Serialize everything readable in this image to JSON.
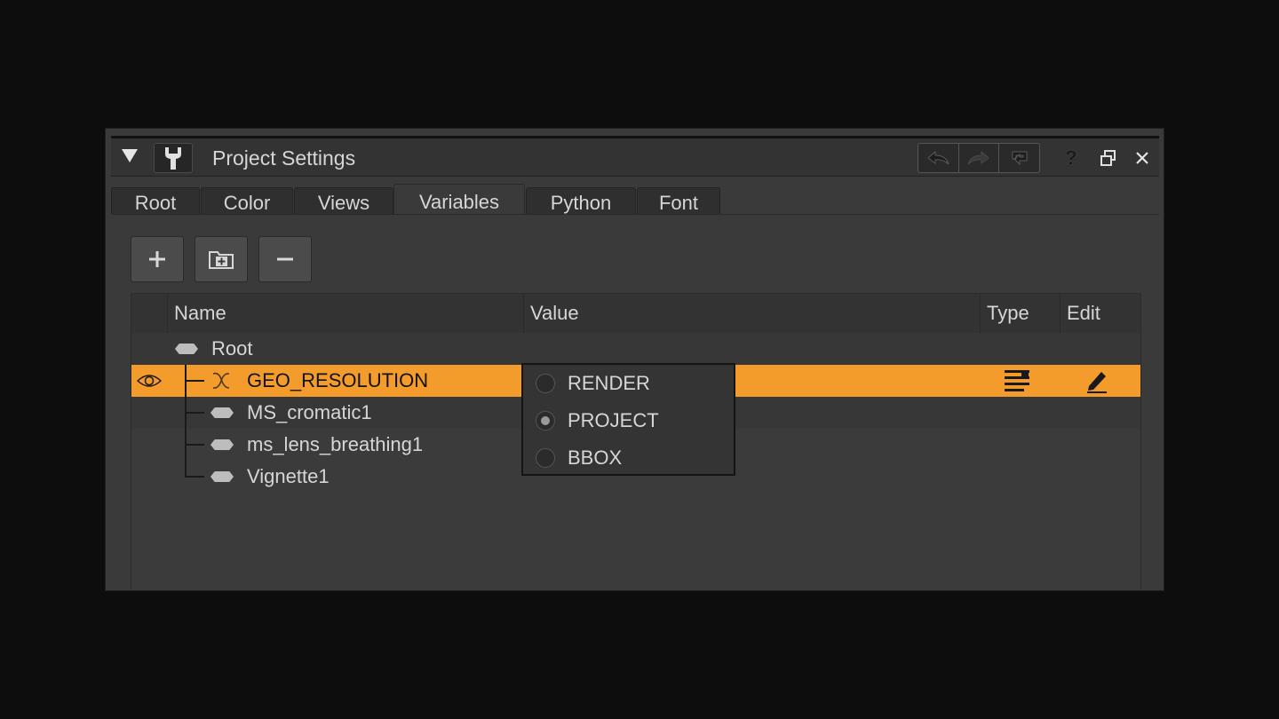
{
  "window": {
    "title": "Project Settings"
  },
  "tabs": [
    {
      "label": "Root",
      "active": false
    },
    {
      "label": "Color",
      "active": false
    },
    {
      "label": "Views",
      "active": false
    },
    {
      "label": "Variables",
      "active": true
    },
    {
      "label": "Python",
      "active": false
    },
    {
      "label": "Font",
      "active": false
    }
  ],
  "toolbar": {
    "add_icon": "plus-icon",
    "add_group_icon": "folder-plus-icon",
    "remove_icon": "minus-icon"
  },
  "table": {
    "headers": {
      "name": "Name",
      "value": "Value",
      "type": "Type",
      "edit": "Edit"
    },
    "rows": [
      {
        "name": "Root",
        "icon": "group-icon"
      },
      {
        "name": "GEO_RESOLUTION",
        "icon": "variable-x-icon",
        "selected": true
      },
      {
        "name": "MS_cromatic1",
        "icon": "group-icon"
      },
      {
        "name": "ms_lens_breathing1",
        "icon": "group-icon"
      },
      {
        "name": "Vignette1",
        "icon": "group-icon"
      }
    ]
  },
  "dropdown": {
    "options": [
      "RENDER",
      "PROJECT",
      "BBOX"
    ],
    "selected": "PROJECT"
  },
  "colors": {
    "accent": "#f39c2b",
    "panel": "#3a3a3a",
    "background": "#0d0d0d"
  }
}
